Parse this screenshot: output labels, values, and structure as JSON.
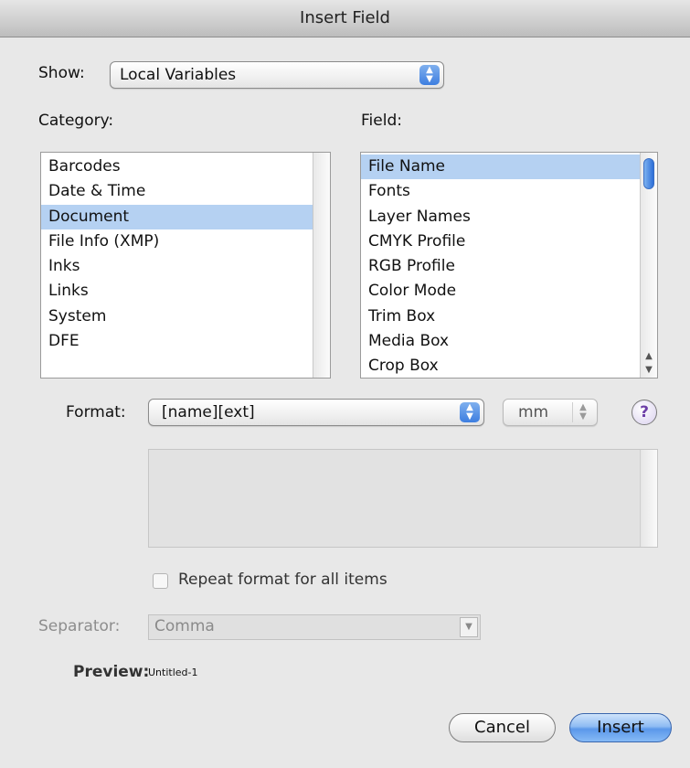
{
  "window": {
    "title": "Insert Field"
  },
  "show": {
    "label": "Show:",
    "value": "Local Variables"
  },
  "category": {
    "label": "Category:",
    "items": [
      "Barcodes",
      "Date & Time",
      "Document",
      "File Info (XMP)",
      "Inks",
      "Links",
      "System",
      "DFE"
    ],
    "selected": "Document"
  },
  "field": {
    "label": "Field:",
    "items": [
      "File Name",
      "Fonts",
      "Layer Names",
      "CMYK Profile",
      "RGB Profile",
      "Color Mode",
      "Trim Box",
      "Media Box",
      "Crop Box"
    ],
    "selected": "File Name"
  },
  "format": {
    "label": "Format:",
    "value": "[name][ext]",
    "unit": "mm",
    "help": "?"
  },
  "repeat": {
    "label": "Repeat format for all items",
    "checked": false
  },
  "separator": {
    "label": "Separator:",
    "value": "Comma"
  },
  "preview": {
    "label": "Preview:",
    "value": "Untitled-1"
  },
  "buttons": {
    "cancel": "Cancel",
    "insert": "Insert"
  },
  "colors": {
    "selection": "#b5d1f2",
    "accent": "#3d7ee0",
    "background": "#e8e8e8"
  }
}
